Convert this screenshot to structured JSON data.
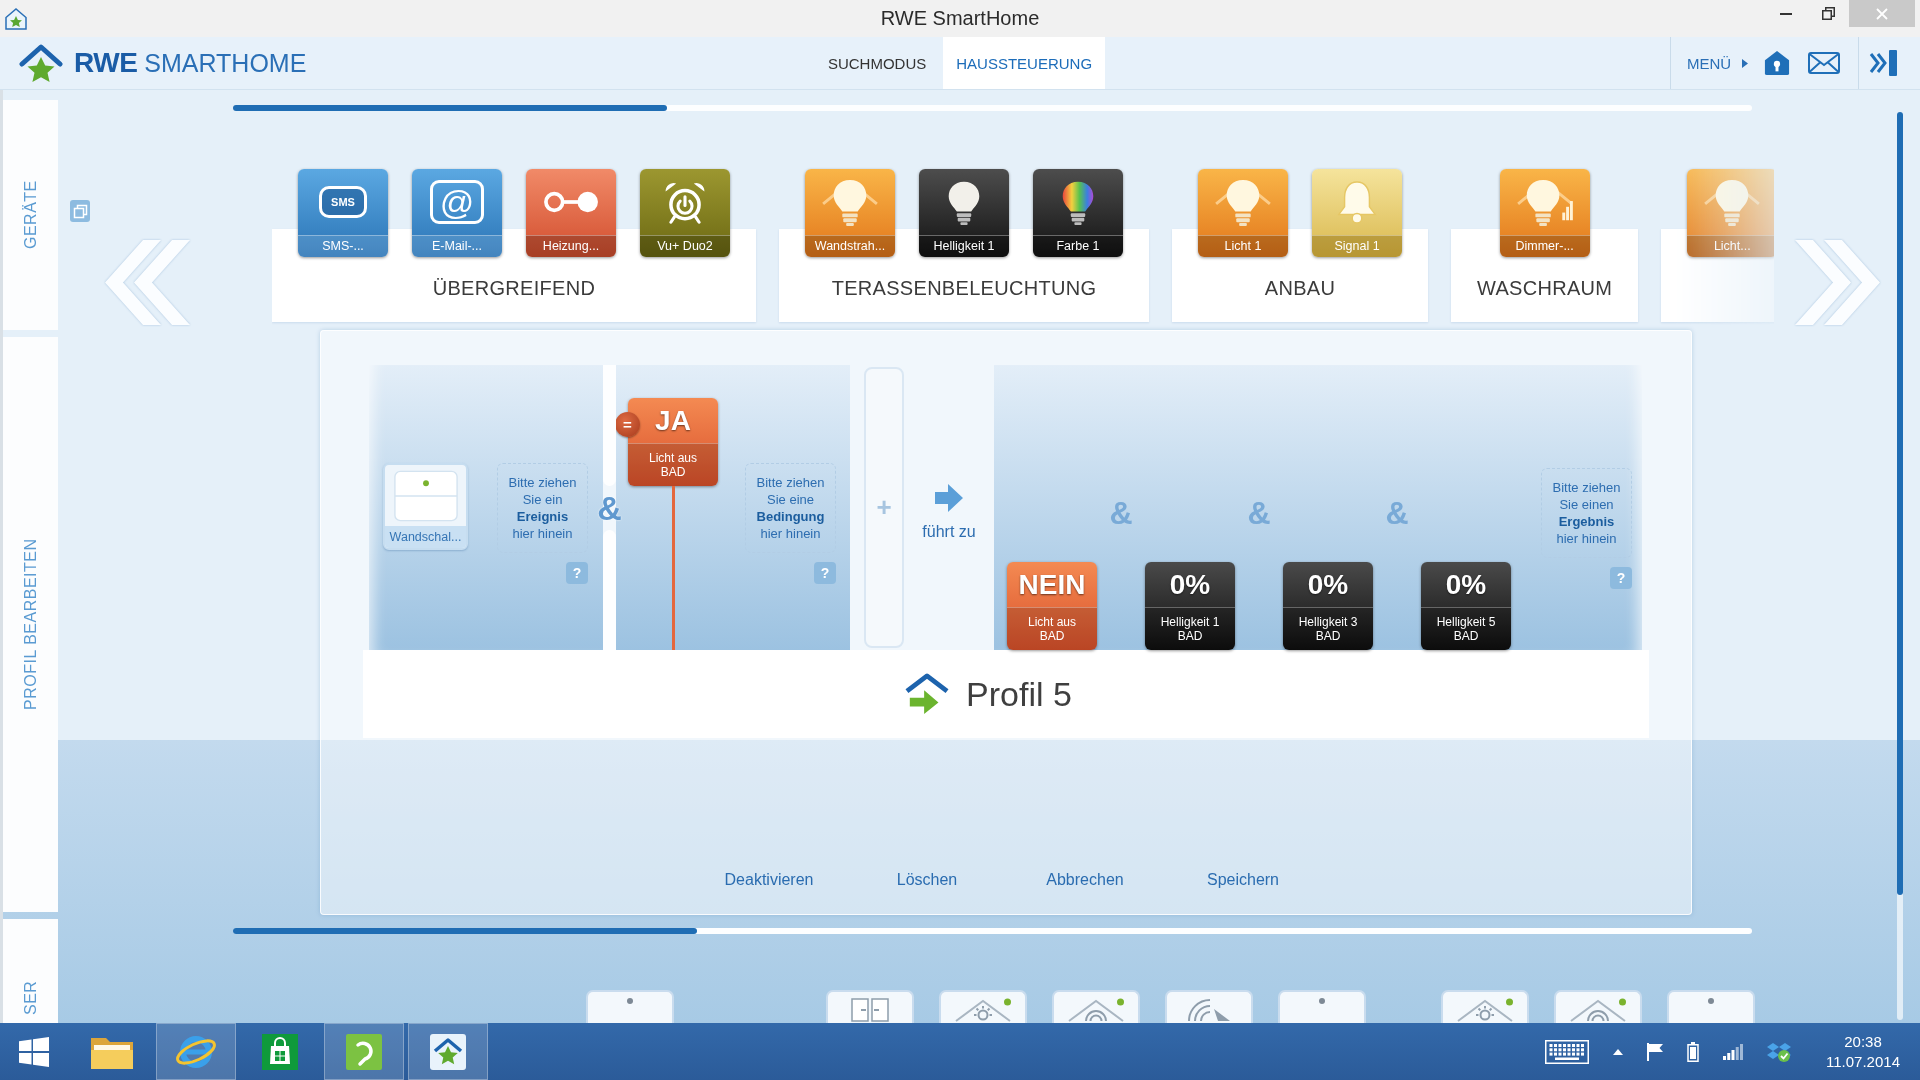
{
  "window": {
    "title": "RWE SmartHome"
  },
  "header": {
    "logo": "**RWE** SMARTHOME",
    "tabs": [
      {
        "label": "SUCHMODUS",
        "selected": false
      },
      {
        "label": "HAUSSTEUERUNG",
        "selected": true
      }
    ],
    "menu": "MENÜ"
  },
  "sidebar": {
    "tabs": [
      {
        "label": "GERÄTE"
      },
      {
        "label": "PROFIL BEARBEITEN"
      },
      {
        "label": "SER"
      }
    ]
  },
  "device_groups": [
    {
      "name": "ÜBERGREIFEND",
      "devices": [
        {
          "kind": "sms",
          "icon_text": "SMS",
          "label": "SMS-..."
        },
        {
          "kind": "email",
          "icon_text": "@",
          "label": "E-Mail-..."
        },
        {
          "kind": "heating",
          "label": "Heizung..."
        },
        {
          "kind": "alarm",
          "label": "Vu+ Duo2"
        }
      ]
    },
    {
      "name": "TERASSENBELEUCHTUNG",
      "devices": [
        {
          "kind": "lamp",
          "label": "Wandstrah..."
        },
        {
          "kind": "bulb",
          "label": "Helligkeit 1"
        },
        {
          "kind": "color-bulb",
          "label": "Farbe 1"
        }
      ]
    },
    {
      "name": "ANBAU",
      "devices": [
        {
          "kind": "lamp",
          "label": "Licht 1"
        },
        {
          "kind": "bell",
          "label": "Signal 1"
        }
      ]
    },
    {
      "name": "WASCHRAUM",
      "devices": [
        {
          "kind": "dimmer",
          "label": "Dimmer-..."
        }
      ]
    },
    {
      "devices": [
        {
          "kind": "lamp",
          "label": "Licht..."
        }
      ]
    }
  ],
  "profile": {
    "events": {
      "items": [
        {
          "kind": "wall-switch",
          "label": "Wandschal..."
        }
      ],
      "drop_hint": "Bitte ziehen Sie ein **Ereignis** hier hinein",
      "help": "?"
    },
    "conjunction": "&",
    "conditions": {
      "items": [
        {
          "kind": "state",
          "operator": "=",
          "value": "JA",
          "label": "Licht aus",
          "room": "BAD"
        }
      ],
      "drop_hint": "Bitte ziehen Sie eine **Bedingung** hier hinein",
      "help": "?"
    },
    "add_slot": "+",
    "leads_to": "führt zu",
    "results": {
      "items": [
        {
          "kind": "state",
          "value": "NEIN",
          "label": "Licht aus",
          "room": "BAD"
        },
        {
          "kind": "dimmer",
          "joiner": "&",
          "value": "0%",
          "label": "Helligkeit 1",
          "room": "BAD"
        },
        {
          "kind": "dimmer",
          "joiner": "&",
          "value": "0%",
          "label": "Helligkeit 3",
          "room": "BAD"
        },
        {
          "kind": "dimmer",
          "joiner": "&",
          "value": "0%",
          "label": "Helligkeit 5",
          "room": "BAD"
        }
      ],
      "drop_hint": "Bitte ziehen Sie einen **Ergebnis** hier hinein",
      "help": "?"
    },
    "name": "Profil 5",
    "actions": [
      "Deaktivieren",
      "Löschen",
      "Abbrechen",
      "Speichern"
    ]
  },
  "bottom_groups": [
    {
      "devices": [
        {
          "kind": "switch"
        }
      ]
    },
    {
      "devices": [
        {
          "kind": "window"
        },
        {
          "kind": "house-light"
        },
        {
          "kind": "house-signal"
        },
        {
          "kind": "signal"
        },
        {
          "kind": "switch"
        }
      ]
    },
    {
      "devices": [
        {
          "kind": "house-light"
        },
        {
          "kind": "house-signal"
        },
        {
          "kind": "switch"
        }
      ]
    }
  ],
  "taskbar": {
    "apps": [
      {
        "kind": "folder",
        "running": false
      },
      {
        "kind": "browser",
        "running": true
      },
      {
        "kind": "store",
        "running": false
      },
      {
        "kind": "phone",
        "running": true
      },
      {
        "kind": "smarthome",
        "running": true
      }
    ],
    "clock": {
      "time": "20:38",
      "date": "11.07.2014"
    }
  }
}
